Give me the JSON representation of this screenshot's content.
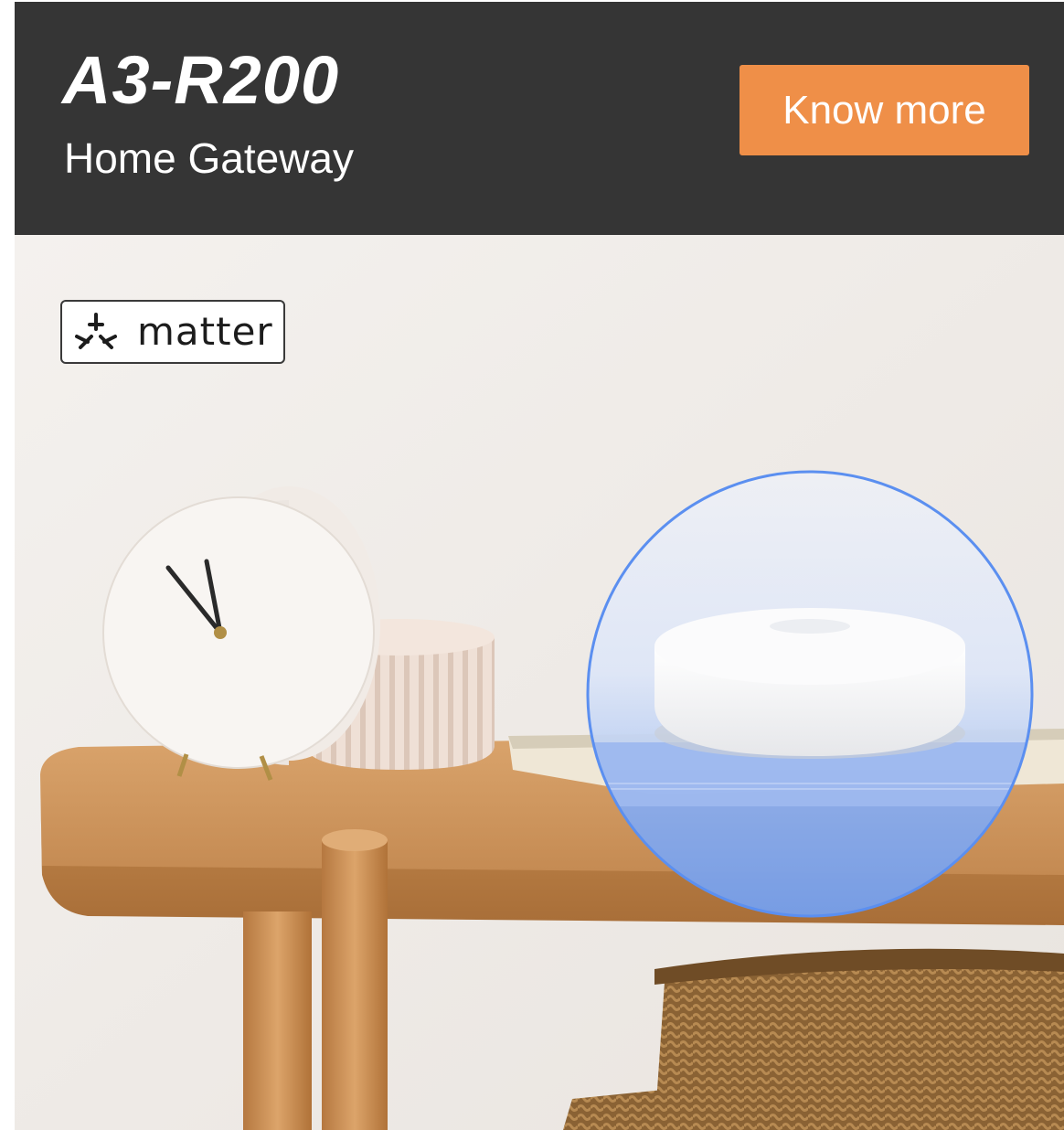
{
  "product": {
    "model": "A3-R200",
    "type": "Home Gateway"
  },
  "cta": {
    "label": "Know more"
  },
  "badge": {
    "label": "matter",
    "icon": "matter-logo-icon"
  },
  "colors": {
    "header_bg": "#353535",
    "cta_bg": "#ef8f48",
    "highlight_ring": "#5b8ff0"
  }
}
